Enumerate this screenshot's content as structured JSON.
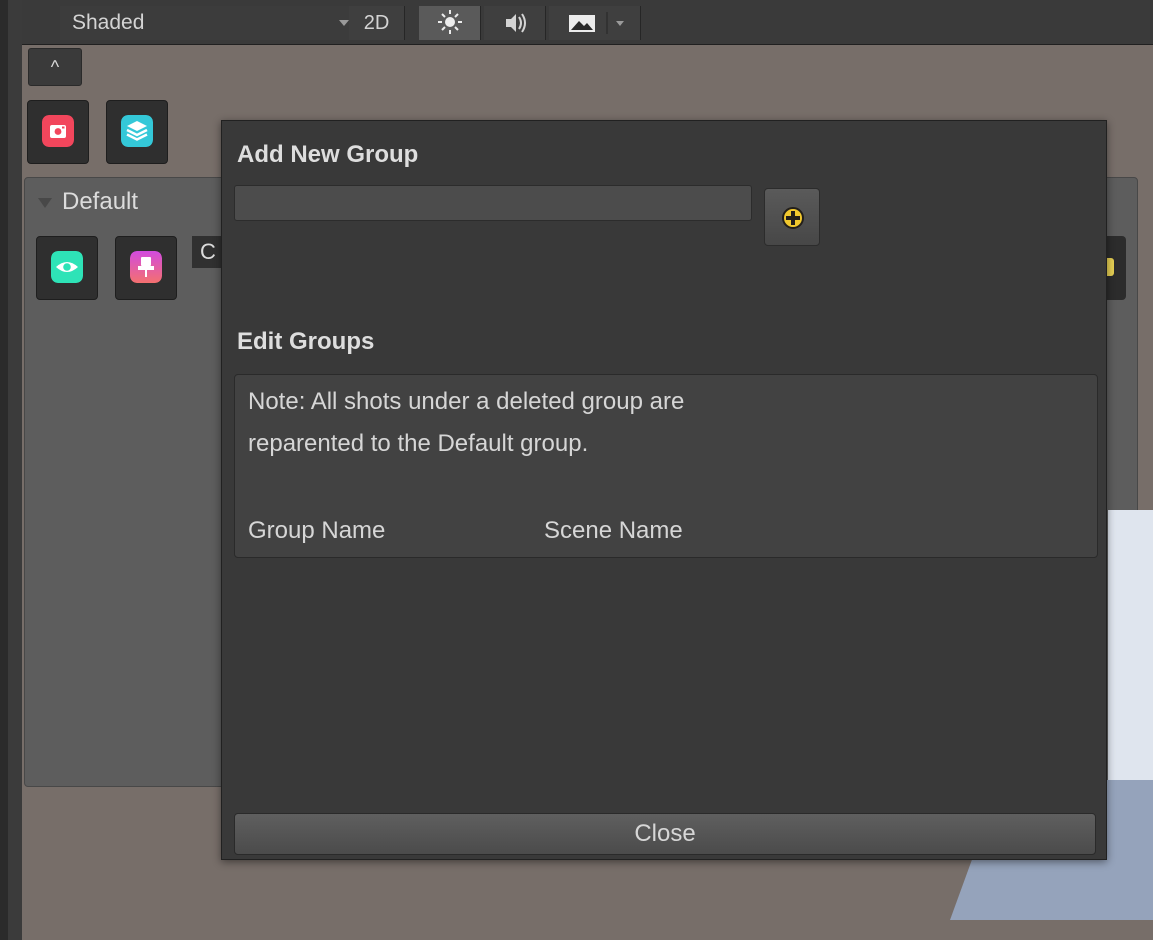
{
  "toolbar": {
    "shading_mode": "Shaded",
    "mode_2d_label": "2D",
    "icons": [
      "sun-icon",
      "audio-icon",
      "image-icon"
    ]
  },
  "collapse_button": "^",
  "group_panel": {
    "header": "Default",
    "clipped_label": "C"
  },
  "dialog": {
    "add_title": "Add New Group",
    "group_name_value": "",
    "edit_title": "Edit Groups",
    "note_line1": "Note: All shots under a deleted group are",
    "note_line2": "reparented to the Default group.",
    "columns": [
      "Group Name",
      "Scene Name"
    ],
    "close_label": "Close"
  },
  "colors": {
    "camera": "#f2465c",
    "layers": "#34c8d8",
    "eye": "#2ee3b7",
    "pin": "#d14be0",
    "plus": "#f2c92e"
  }
}
